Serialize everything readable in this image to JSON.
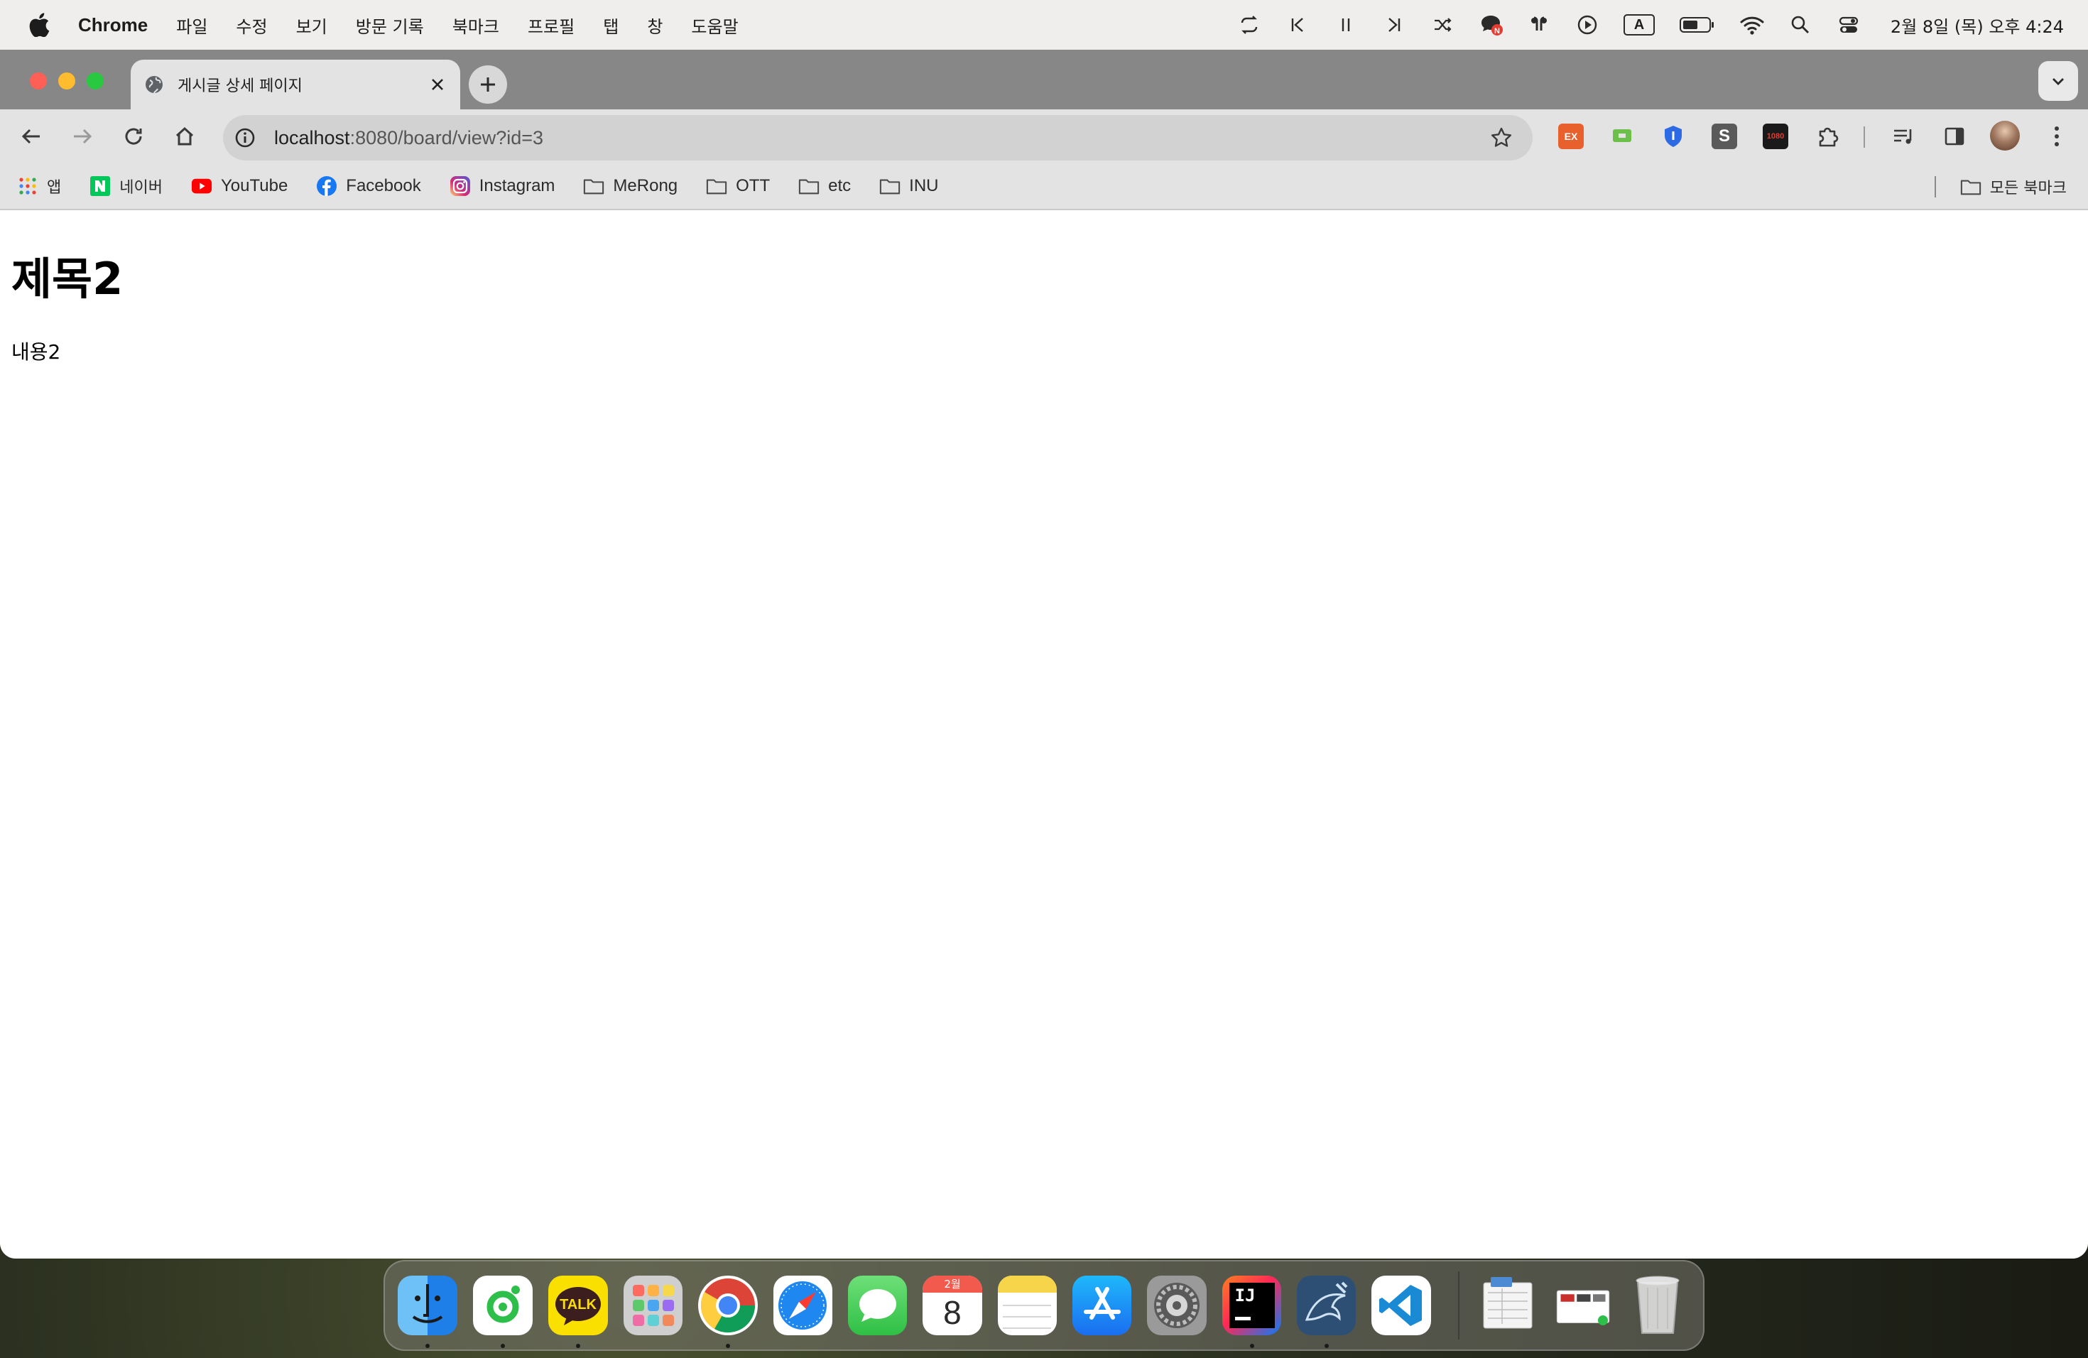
{
  "menubar": {
    "app_name": "Chrome",
    "menus": [
      "파일",
      "수정",
      "보기",
      "방문 기록",
      "북마크",
      "프로필",
      "탭",
      "창",
      "도움말"
    ],
    "clock": "2월 8일 (목) 오후 4:24",
    "status_icons": [
      "repeat-icon",
      "previous-track-icon",
      "pause-icon",
      "next-track-icon",
      "shuffle-icon",
      "chat-notification-icon",
      "airpods-icon",
      "play-circle-icon",
      "input-source-icon",
      "battery-icon",
      "wifi-icon",
      "spotlight-search-icon",
      "control-center-icon"
    ],
    "input_source_label": "A",
    "chat_badge": "N"
  },
  "browser": {
    "tab": {
      "title": "게시글 상세 페이지"
    },
    "address": {
      "host": "localhost",
      "path": ":8080/board/view?id=3"
    },
    "extensions": [
      {
        "name": "ex-extension-icon",
        "label": "EX",
        "color": "#e8602c"
      },
      {
        "name": "green-extension-icon",
        "label": "",
        "color": "#6cc04a"
      },
      {
        "name": "shield-extension-icon",
        "label": "",
        "color": "#2d6be4"
      },
      {
        "name": "s-extension-icon",
        "label": "S",
        "color": "#5a5a5a"
      },
      {
        "name": "1080-extension-icon",
        "label": "1080",
        "color": "#1a1a1a"
      }
    ],
    "bookmarks": [
      {
        "name": "apps",
        "label": "앱",
        "icon": "apps-grid-icon"
      },
      {
        "name": "naver",
        "label": "네이버",
        "icon": "naver-icon"
      },
      {
        "name": "youtube",
        "label": "YouTube",
        "icon": "youtube-icon"
      },
      {
        "name": "facebook",
        "label": "Facebook",
        "icon": "facebook-icon"
      },
      {
        "name": "instagram",
        "label": "Instagram",
        "icon": "instagram-icon"
      },
      {
        "name": "merong",
        "label": "MeRong",
        "icon": "folder-icon"
      },
      {
        "name": "ott",
        "label": "OTT",
        "icon": "folder-icon"
      },
      {
        "name": "etc",
        "label": "etc",
        "icon": "folder-icon"
      },
      {
        "name": "inu",
        "label": "INU",
        "icon": "folder-icon"
      }
    ],
    "all_bookmarks_label": "모든 북마크"
  },
  "page": {
    "title": "제목2",
    "content": "내용2"
  },
  "dock": {
    "apps": [
      {
        "name": "finder",
        "color": "#3d8ef0",
        "running": true
      },
      {
        "name": "naver-whale",
        "color": "#ffffff",
        "running": true
      },
      {
        "name": "kakaotalk",
        "label": "TALK",
        "color": "#f9e000",
        "running": true
      },
      {
        "name": "launchpad",
        "color": "#d0d0d0",
        "running": false
      },
      {
        "name": "chrome",
        "color": "#ffffff",
        "running": true
      },
      {
        "name": "safari",
        "color": "#ffffff",
        "running": false
      },
      {
        "name": "messages",
        "color": "#3ecb52",
        "running": false
      },
      {
        "name": "calendar",
        "label_month": "2월",
        "label_day": "8",
        "color": "#ffffff",
        "running": false
      },
      {
        "name": "notes",
        "color": "#ffffff",
        "running": false
      },
      {
        "name": "app-store",
        "color": "#1f8cf3",
        "running": false
      },
      {
        "name": "system-settings",
        "color": "#8c8c8c",
        "running": false
      },
      {
        "name": "intellij-idea",
        "label": "IJ",
        "color": "#000000",
        "running": true
      },
      {
        "name": "mysql-workbench",
        "color": "#2e4f74",
        "running": true
      },
      {
        "name": "vscode",
        "color": "#ffffff",
        "running": false
      }
    ],
    "recent": [
      "xlsx-document",
      "screenshot-stack"
    ],
    "trash": "trash"
  }
}
